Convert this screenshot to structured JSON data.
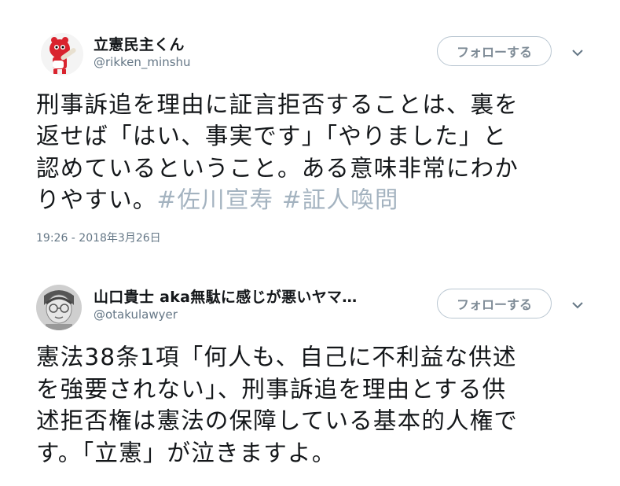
{
  "tweets": [
    {
      "display_name": "立憲民主くん",
      "handle": "@rikken_minshu",
      "follow_label": "フォローする",
      "lines": [
        "刑事訴追を理由に証言拒否することは、裏を",
        "返せば「はい、事実です」「やりました」と",
        "認めているということ。ある意味非常にわか"
      ],
      "last_line_text": "りやすい。",
      "hashtags": [
        "#佐川宣寿",
        "#証人喚問"
      ],
      "timestamp": "19:26 - 2018年3月26日",
      "avatar_icon": "mascot-avatar-icon"
    },
    {
      "display_name": "山口貴士 aka無駄に感じが悪いヤマ…",
      "handle": "@otakulawyer",
      "follow_label": "フォローする",
      "lines": [
        "憲法38条1項「何人も、自己に不利益な供述",
        "を強要されない」、刑事訴追を理由とする供",
        "述拒否権は憲法の保障している基本的人権で",
        "す。「立憲」が泣きますよ。"
      ],
      "avatar_icon": "sketch-face-avatar-icon"
    }
  ],
  "colors": {
    "text": "#14171a",
    "secondary": "#657786",
    "hashtag": "#a4b3c0",
    "button_border": "#b9c6d1"
  }
}
